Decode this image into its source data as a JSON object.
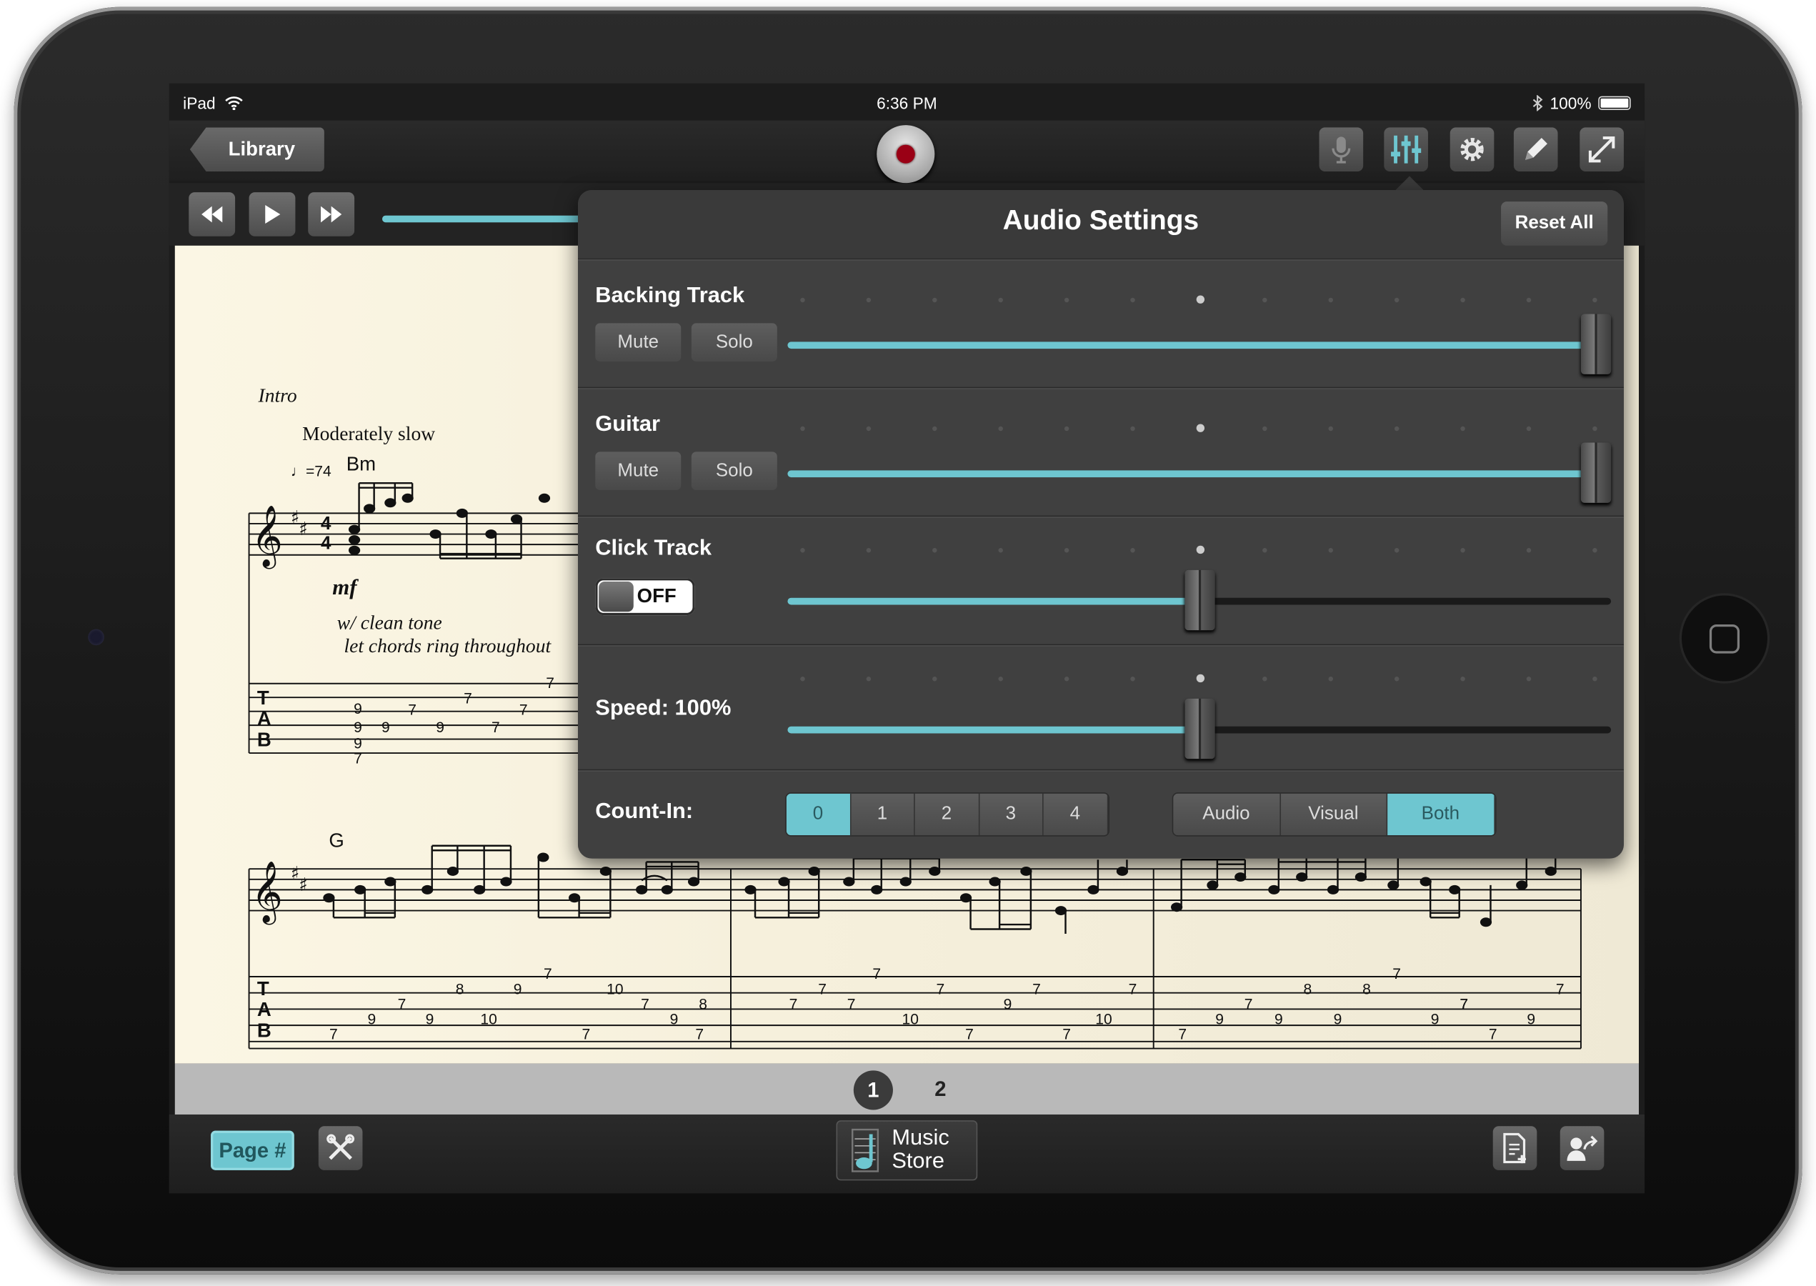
{
  "status": {
    "device": "iPad",
    "time": "6:36 PM",
    "battery": "100%"
  },
  "toolbar": {
    "library_label": "Library"
  },
  "transport": {
    "progress": 0.28
  },
  "sheet": {
    "intro": "Intro",
    "tempo_text": "Moderately slow",
    "bpm": "=74",
    "dynamic": "mf",
    "note1": "w/ clean tone",
    "note2": "let chords ring throughout",
    "chord1": "Bm",
    "chord2": "G",
    "tab_letters": [
      "T",
      "A",
      "B"
    ],
    "row1_tab": [
      "7",
      "7",
      "7",
      "7",
      "9",
      "9",
      "9",
      "9",
      "9",
      "7",
      "7"
    ],
    "row2_tab": [
      "7",
      "8",
      "9",
      "7",
      "9",
      "9",
      "10",
      "7",
      "7",
      "8",
      "10",
      "7",
      "9",
      "7",
      "7",
      "7",
      "7",
      "7",
      "10",
      "7",
      "7",
      "7",
      "9",
      "7",
      "10",
      "7",
      "7",
      "9",
      "7",
      "9",
      "8",
      "8",
      "9",
      "7",
      "9",
      "7",
      "9",
      "7",
      "7",
      "7",
      "7"
    ]
  },
  "pager": {
    "pages": [
      "1",
      "2"
    ],
    "current": "1"
  },
  "bottom": {
    "page_btn": "Page #",
    "store_line1": "Music",
    "store_line2": "Store"
  },
  "panel": {
    "title": "Audio Settings",
    "reset": "Reset All",
    "mute": "Mute",
    "solo": "Solo",
    "backing_label": "Backing Track",
    "backing_level": 1.0,
    "guitar_label": "Guitar",
    "guitar_level": 1.0,
    "click_label": "Click Track",
    "click_toggle": "OFF",
    "click_level": 0.5,
    "speed_label": "Speed: 100%",
    "speed_level": 0.5,
    "countin_label": "Count-In:",
    "countin_options": [
      "0",
      "1",
      "2",
      "3",
      "4"
    ],
    "countin_selected": "0",
    "mode_options": [
      "Audio",
      "Visual",
      "Both"
    ],
    "mode_selected": "Both"
  },
  "colors": {
    "accent": "#6ec6d0",
    "record": "#9a0015"
  }
}
